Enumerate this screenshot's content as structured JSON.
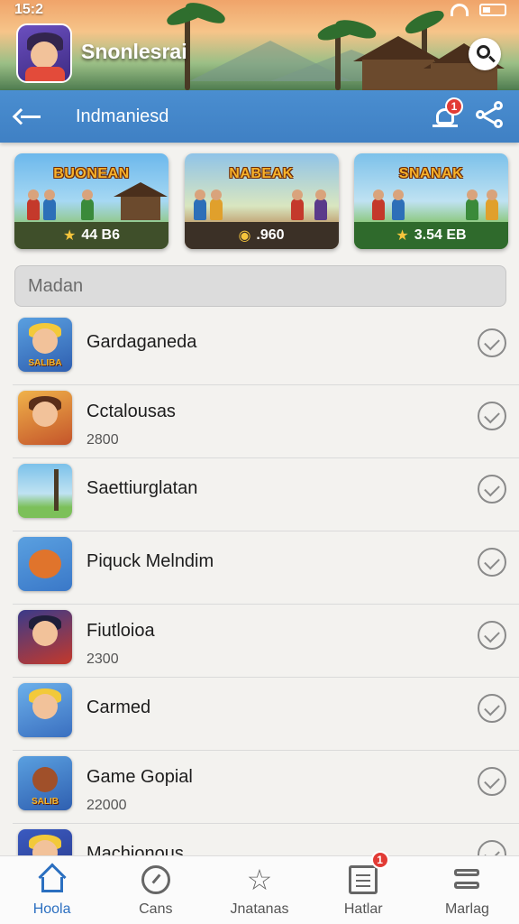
{
  "status": {
    "time": "15:2"
  },
  "app": {
    "name": "Snonlesrai",
    "search_icon": "search-icon"
  },
  "header": {
    "title": "Indmaniesd",
    "notif_badge": "1",
    "back_icon": "back-arrow-icon",
    "share_icon": "share-icon"
  },
  "featured": [
    {
      "logo": "BUONEAN",
      "rating": "44 B6",
      "icon": "star-icon"
    },
    {
      "logo": "NABEAK",
      "rating": ".960",
      "icon": "coin-icon"
    },
    {
      "logo": "SNANAK",
      "rating": "3.54 EB",
      "icon": "star-icon"
    }
  ],
  "section": {
    "title": "Madan"
  },
  "list": [
    {
      "title": "Gardaganeda",
      "sub": ""
    },
    {
      "title": "Cctalousas",
      "sub": "2800"
    },
    {
      "title": "Saettiurglatan",
      "sub": ""
    },
    {
      "title": "Piquck Melndim",
      "sub": ""
    },
    {
      "title": "Fiutloioa",
      "sub": "2300"
    },
    {
      "title": "Carmed",
      "sub": ""
    },
    {
      "title": "Game Gopial",
      "sub": "22000"
    },
    {
      "title": "Machionous",
      "sub": ""
    }
  ],
  "nav": {
    "items": [
      {
        "label": "Hoola"
      },
      {
        "label": "Cans"
      },
      {
        "label": "Jnatanas"
      },
      {
        "label": "Hatlar",
        "badge": "1"
      },
      {
        "label": "Marlag"
      }
    ]
  },
  "colors": {
    "accent": "#2b6fc0",
    "header_bar": "#4589cc",
    "badge": "#e23b35"
  }
}
